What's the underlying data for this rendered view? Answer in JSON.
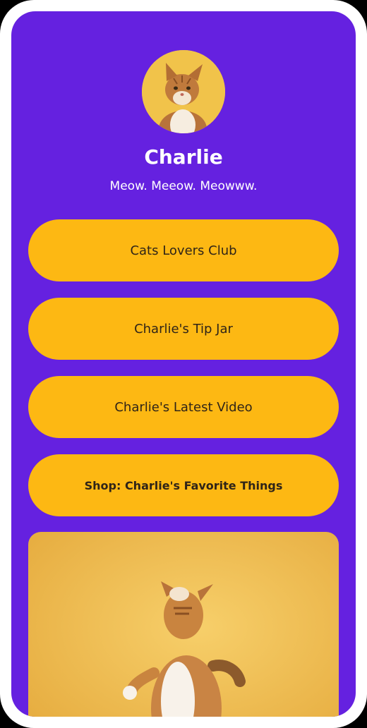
{
  "profile": {
    "name": "Charlie",
    "bio": "Meow. Meeow. Meowww.",
    "avatar_icon": "cat-photo"
  },
  "links": [
    {
      "label": "Cats Lovers Club"
    },
    {
      "label": "Charlie's Tip Jar"
    },
    {
      "label": "Charlie's Latest Video"
    },
    {
      "label": "Shop: Charlie's Favorite Things"
    }
  ],
  "featured_media": {
    "icon": "cat-jumping-photo"
  },
  "colors": {
    "background": "#6521e0",
    "button": "#fdb813",
    "button_text": "#2f2418",
    "text": "#ffffff"
  }
}
